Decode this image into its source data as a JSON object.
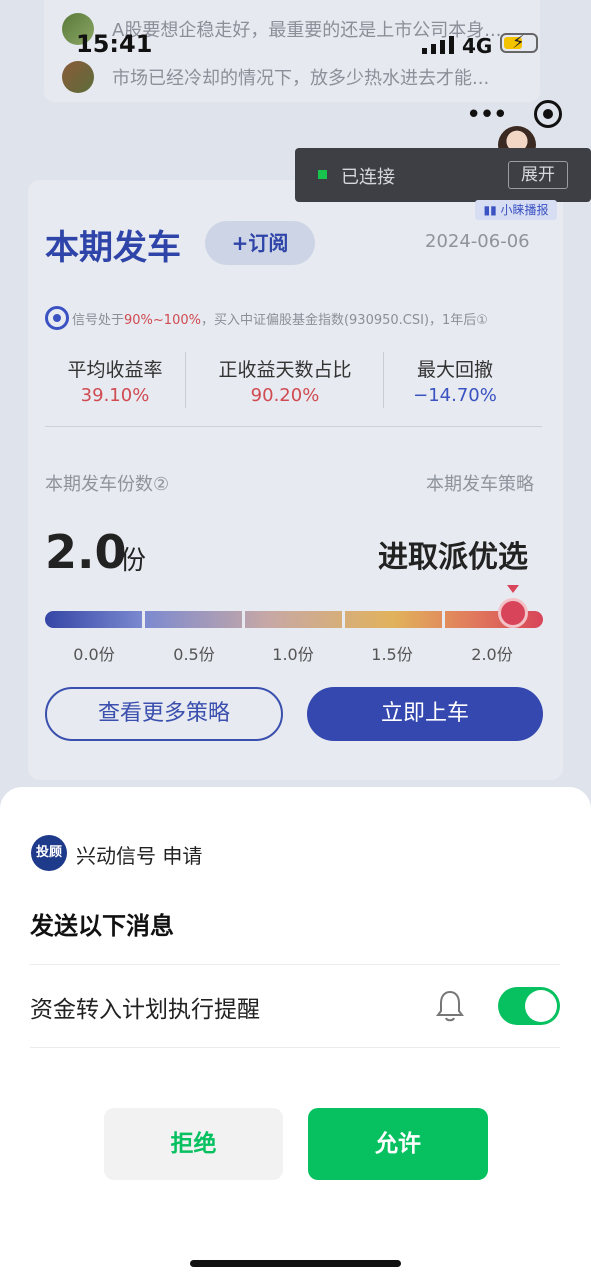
{
  "status_bar": {
    "time": "15:41",
    "network": "4G"
  },
  "news": [
    {
      "text": "A股要想企稳走好，最重要的还是上市公司本身..."
    },
    {
      "text": "市场已经冷却的情况下，放多少热水进去才能..."
    }
  ],
  "live": {
    "connected_label": "已连接",
    "expand_label": "展开",
    "voice_tag": "小睐播报"
  },
  "header": {
    "title": "本期发车",
    "subscribe_label": "+订阅",
    "date": "2024-06-06"
  },
  "signal_line": {
    "prefix": "信号处于",
    "range": "90%~100%",
    "suffix": "，买入中证偏股基金指数(930950.CSI)，1年后①"
  },
  "stats": [
    {
      "label": "平均收益率",
      "value": "39.10%",
      "color": "#d04a52"
    },
    {
      "label": "正收益天数占比",
      "value": "90.20%",
      "color": "#d04a52"
    },
    {
      "label": "最大回撤",
      "value": "−14.70%",
      "color": "#3a52c2"
    }
  ],
  "copies": {
    "label": "本期发车份数②",
    "value": "2.0",
    "unit": "份",
    "level_fraction": 1.0
  },
  "strategy": {
    "label": "本期发车策略",
    "value": "进取派优选"
  },
  "scale_ticks": [
    "0.0份",
    "0.5份",
    "1.0份",
    "1.5份",
    "2.0份"
  ],
  "actions": {
    "more_strategies": "查看更多策略",
    "board_now": "立即上车"
  },
  "sheet": {
    "app_logo_text": "投顾",
    "app_name": "兴动信号 申请",
    "title": "发送以下消息",
    "message_label": "资金转入计划执行提醒",
    "toggle_on": true,
    "reject_label": "拒绝",
    "allow_label": "允许"
  },
  "colors": {
    "accent": "#07c160",
    "brand_blue": "#3448b0"
  }
}
